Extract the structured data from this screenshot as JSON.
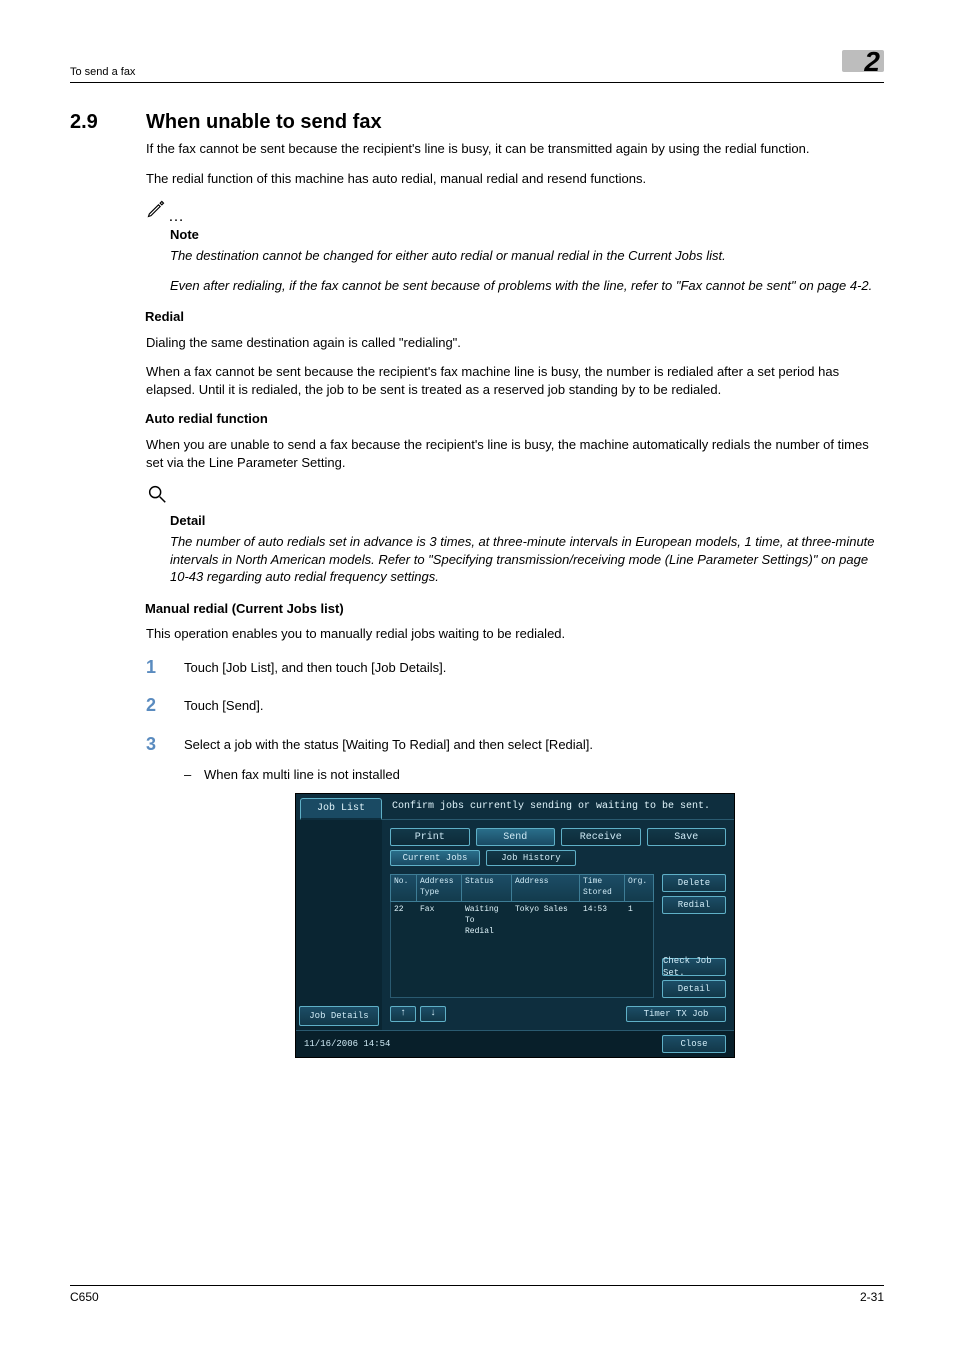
{
  "running_header": {
    "left": "To send a fax",
    "chapter_number": "2"
  },
  "section": {
    "number": "2.9",
    "title": "When unable to send fax"
  },
  "intro_p1": "If the fax cannot be sent because the recipient's line is busy, it can be transmitted again by using the redial function.",
  "intro_p2": "The redial function of this machine has auto redial, manual redial and resend functions.",
  "note": {
    "label": "Note",
    "line1": "The destination cannot be changed for either auto redial or manual redial in the Current Jobs list.",
    "line2": "Even after redialing, if the fax cannot be sent because of problems with the line, refer to \"Fax cannot be sent\" on page 4-2."
  },
  "redial": {
    "heading": "Redial",
    "p1": "Dialing the same destination again is called \"redialing\".",
    "p2": "When a fax cannot be sent because the recipient's fax machine line is busy, the number is redialed after a set period has elapsed. Until it is redialed, the job to be sent is treated as a reserved job standing by to be redialed."
  },
  "auto_redial": {
    "heading": "Auto redial function",
    "p1": "When you are unable to send a fax because the recipient's line is busy, the machine automatically redials the number of times set via the Line Parameter Setting."
  },
  "detail": {
    "label": "Detail",
    "text": "The number of auto redials set in advance is 3 times, at three-minute intervals in European models, 1 time, at three-minute intervals in North American models. Refer to \"Specifying transmission/receiving mode (Line Parameter Settings)\" on page 10-43 regarding auto redial frequency settings."
  },
  "manual_redial": {
    "heading": "Manual redial (Current Jobs list)",
    "p1": "This operation enables you to manually redial jobs waiting to be redialed.",
    "steps": {
      "s1": "Touch [Job List], and then touch [Job Details].",
      "s2": "Touch [Send].",
      "s3": "Select a job with the status [Waiting To Redial] and then select [Redial].",
      "s3_sub": "When fax multi line is not installed"
    }
  },
  "screenshot": {
    "job_list_tab": "Job List",
    "top_message": "Confirm jobs currently sending or waiting to be sent.",
    "tabs": {
      "print": "Print",
      "send": "Send",
      "receive": "Receive",
      "save": "Save"
    },
    "subtabs": {
      "current": "Current Jobs",
      "history": "Job History"
    },
    "columns": {
      "no": "No.",
      "type": "Address Type",
      "status": "Status",
      "address": "Address",
      "time": "Time Stored",
      "org": "Org."
    },
    "row": {
      "no": "22",
      "type": "Fax",
      "status": "Waiting To Redial",
      "address": "Tokyo Sales",
      "time": "14:53",
      "org": "1"
    },
    "side": {
      "delete": "Delete",
      "redial": "Redial",
      "check": "Check Job Set.",
      "detail": "Detail"
    },
    "timer_btn": "Timer TX Job",
    "left_bottom_btn": "Job Details",
    "footer_ts": "11/16/2006   14:54",
    "close": "Close"
  },
  "footer": {
    "left": "C650",
    "right": "2-31"
  }
}
